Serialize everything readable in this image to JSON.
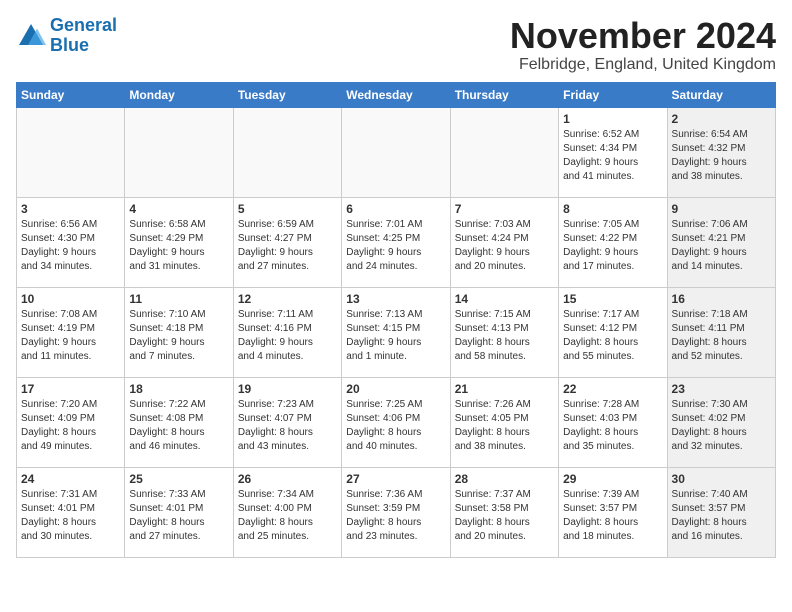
{
  "logo": {
    "line1": "General",
    "line2": "Blue"
  },
  "title": "November 2024",
  "location": "Felbridge, England, United Kingdom",
  "days_of_week": [
    "Sunday",
    "Monday",
    "Tuesday",
    "Wednesday",
    "Thursday",
    "Friday",
    "Saturday"
  ],
  "weeks": [
    [
      {
        "day": "",
        "info": "",
        "shaded": true
      },
      {
        "day": "",
        "info": "",
        "shaded": true
      },
      {
        "day": "",
        "info": "",
        "shaded": true
      },
      {
        "day": "",
        "info": "",
        "shaded": true
      },
      {
        "day": "",
        "info": "",
        "shaded": true
      },
      {
        "day": "1",
        "info": "Sunrise: 6:52 AM\nSunset: 4:34 PM\nDaylight: 9 hours\nand 41 minutes.",
        "shaded": false
      },
      {
        "day": "2",
        "info": "Sunrise: 6:54 AM\nSunset: 4:32 PM\nDaylight: 9 hours\nand 38 minutes.",
        "shaded": true
      }
    ],
    [
      {
        "day": "3",
        "info": "Sunrise: 6:56 AM\nSunset: 4:30 PM\nDaylight: 9 hours\nand 34 minutes.",
        "shaded": false
      },
      {
        "day": "4",
        "info": "Sunrise: 6:58 AM\nSunset: 4:29 PM\nDaylight: 9 hours\nand 31 minutes.",
        "shaded": false
      },
      {
        "day": "5",
        "info": "Sunrise: 6:59 AM\nSunset: 4:27 PM\nDaylight: 9 hours\nand 27 minutes.",
        "shaded": false
      },
      {
        "day": "6",
        "info": "Sunrise: 7:01 AM\nSunset: 4:25 PM\nDaylight: 9 hours\nand 24 minutes.",
        "shaded": false
      },
      {
        "day": "7",
        "info": "Sunrise: 7:03 AM\nSunset: 4:24 PM\nDaylight: 9 hours\nand 20 minutes.",
        "shaded": false
      },
      {
        "day": "8",
        "info": "Sunrise: 7:05 AM\nSunset: 4:22 PM\nDaylight: 9 hours\nand 17 minutes.",
        "shaded": false
      },
      {
        "day": "9",
        "info": "Sunrise: 7:06 AM\nSunset: 4:21 PM\nDaylight: 9 hours\nand 14 minutes.",
        "shaded": true
      }
    ],
    [
      {
        "day": "10",
        "info": "Sunrise: 7:08 AM\nSunset: 4:19 PM\nDaylight: 9 hours\nand 11 minutes.",
        "shaded": false
      },
      {
        "day": "11",
        "info": "Sunrise: 7:10 AM\nSunset: 4:18 PM\nDaylight: 9 hours\nand 7 minutes.",
        "shaded": false
      },
      {
        "day": "12",
        "info": "Sunrise: 7:11 AM\nSunset: 4:16 PM\nDaylight: 9 hours\nand 4 minutes.",
        "shaded": false
      },
      {
        "day": "13",
        "info": "Sunrise: 7:13 AM\nSunset: 4:15 PM\nDaylight: 9 hours\nand 1 minute.",
        "shaded": false
      },
      {
        "day": "14",
        "info": "Sunrise: 7:15 AM\nSunset: 4:13 PM\nDaylight: 8 hours\nand 58 minutes.",
        "shaded": false
      },
      {
        "day": "15",
        "info": "Sunrise: 7:17 AM\nSunset: 4:12 PM\nDaylight: 8 hours\nand 55 minutes.",
        "shaded": false
      },
      {
        "day": "16",
        "info": "Sunrise: 7:18 AM\nSunset: 4:11 PM\nDaylight: 8 hours\nand 52 minutes.",
        "shaded": true
      }
    ],
    [
      {
        "day": "17",
        "info": "Sunrise: 7:20 AM\nSunset: 4:09 PM\nDaylight: 8 hours\nand 49 minutes.",
        "shaded": false
      },
      {
        "day": "18",
        "info": "Sunrise: 7:22 AM\nSunset: 4:08 PM\nDaylight: 8 hours\nand 46 minutes.",
        "shaded": false
      },
      {
        "day": "19",
        "info": "Sunrise: 7:23 AM\nSunset: 4:07 PM\nDaylight: 8 hours\nand 43 minutes.",
        "shaded": false
      },
      {
        "day": "20",
        "info": "Sunrise: 7:25 AM\nSunset: 4:06 PM\nDaylight: 8 hours\nand 40 minutes.",
        "shaded": false
      },
      {
        "day": "21",
        "info": "Sunrise: 7:26 AM\nSunset: 4:05 PM\nDaylight: 8 hours\nand 38 minutes.",
        "shaded": false
      },
      {
        "day": "22",
        "info": "Sunrise: 7:28 AM\nSunset: 4:03 PM\nDaylight: 8 hours\nand 35 minutes.",
        "shaded": false
      },
      {
        "day": "23",
        "info": "Sunrise: 7:30 AM\nSunset: 4:02 PM\nDaylight: 8 hours\nand 32 minutes.",
        "shaded": true
      }
    ],
    [
      {
        "day": "24",
        "info": "Sunrise: 7:31 AM\nSunset: 4:01 PM\nDaylight: 8 hours\nand 30 minutes.",
        "shaded": false
      },
      {
        "day": "25",
        "info": "Sunrise: 7:33 AM\nSunset: 4:01 PM\nDaylight: 8 hours\nand 27 minutes.",
        "shaded": false
      },
      {
        "day": "26",
        "info": "Sunrise: 7:34 AM\nSunset: 4:00 PM\nDaylight: 8 hours\nand 25 minutes.",
        "shaded": false
      },
      {
        "day": "27",
        "info": "Sunrise: 7:36 AM\nSunset: 3:59 PM\nDaylight: 8 hours\nand 23 minutes.",
        "shaded": false
      },
      {
        "day": "28",
        "info": "Sunrise: 7:37 AM\nSunset: 3:58 PM\nDaylight: 8 hours\nand 20 minutes.",
        "shaded": false
      },
      {
        "day": "29",
        "info": "Sunrise: 7:39 AM\nSunset: 3:57 PM\nDaylight: 8 hours\nand 18 minutes.",
        "shaded": false
      },
      {
        "day": "30",
        "info": "Sunrise: 7:40 AM\nSunset: 3:57 PM\nDaylight: 8 hours\nand 16 minutes.",
        "shaded": true
      }
    ]
  ]
}
